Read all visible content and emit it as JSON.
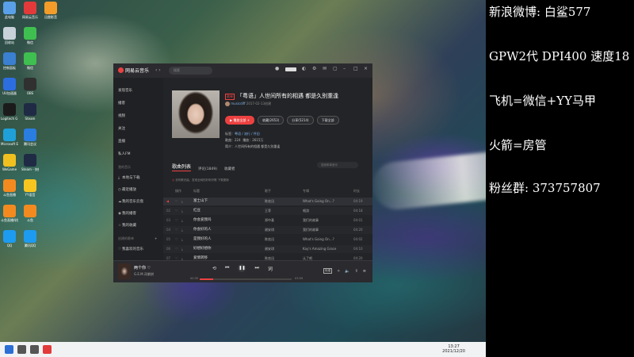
{
  "desktop": {
    "icons": [
      {
        "label": "此电脑",
        "color": "#5aa0e8",
        "col": 0,
        "row": 0
      },
      {
        "label": "网易云音乐",
        "color": "#e23a3a",
        "col": 1,
        "row": 0
      },
      {
        "label": "迅雷影音",
        "color": "#f39c2a",
        "col": 2,
        "row": 0
      },
      {
        "label": "回收站",
        "color": "#c8d0d8",
        "col": 0,
        "row": 1
      },
      {
        "label": "微信",
        "color": "#3fbf4f",
        "col": 1,
        "row": 1
      },
      {
        "label": "控制面板",
        "color": "#3a7fd0",
        "col": 0,
        "row": 2
      },
      {
        "label": "微信",
        "color": "#3fbf4f",
        "col": 1,
        "row": 2
      },
      {
        "label": "UU加速器",
        "color": "#2c6ee0",
        "col": 0,
        "row": 3
      },
      {
        "label": "OBS",
        "color": "#303030",
        "col": 1,
        "row": 3
      },
      {
        "label": "Logitech G HUB",
        "color": "#1b1b1b",
        "col": 0,
        "row": 4
      },
      {
        "label": "Steam",
        "color": "#1f2a44",
        "col": 1,
        "row": 4
      },
      {
        "label": "Microsoft Edge",
        "color": "#1fa0d8",
        "col": 0,
        "row": 5
      },
      {
        "label": "腾讯会议",
        "color": "#2a7de1",
        "col": 1,
        "row": 5
      },
      {
        "label": "WeGame",
        "color": "#f0c020",
        "col": 0,
        "row": 6
      },
      {
        "label": "Steam - 快捷方式",
        "color": "#1f2a44",
        "col": 1,
        "row": 6
      },
      {
        "label": "斗鱼直播",
        "color": "#f28a20",
        "col": 0,
        "row": 7
      },
      {
        "label": "YY语音",
        "color": "#f7c520",
        "col": 1,
        "row": 7
      },
      {
        "label": "斗鱼直播伴侣",
        "color": "#f28a20",
        "col": 0,
        "row": 8
      },
      {
        "label": "斗鱼",
        "color": "#f28a20",
        "col": 1,
        "row": 8
      },
      {
        "label": "QQ",
        "color": "#1d9bf0",
        "col": 0,
        "row": 9
      },
      {
        "label": "腾讯QQ",
        "color": "#1d9bf0",
        "col": 1,
        "row": 9
      }
    ]
  },
  "taskbar": {
    "time": "13:27",
    "date": "2021/12/20",
    "icons": [
      {
        "name": "start-icon",
        "color": "#2b6fd6"
      },
      {
        "name": "search-icon",
        "color": "#555"
      },
      {
        "name": "taskview-icon",
        "color": "#555"
      },
      {
        "name": "netease-taskbar-icon",
        "color": "#e23a3a"
      }
    ]
  },
  "app": {
    "logo_text": "网易云音乐",
    "search_placeholder": "搜索",
    "user_name": "",
    "sidebar": {
      "items": [
        "发现音乐",
        "播客",
        "视频",
        "关注",
        "直播",
        "私人FM"
      ],
      "section_mine": "我的音乐",
      "mine_items": [
        "本地与下载",
        "最近播放",
        "我的音乐云盘",
        "我的播客",
        "我的收藏"
      ],
      "section_created": "创建的歌单",
      "created_items": [
        "我喜欢的音乐"
      ]
    },
    "playlist": {
      "tag": "歌单",
      "title": "「粤语」人世间所有的相遇 都是久别重逢",
      "creator": "musicdiff",
      "created_date": "2017-02-13创建",
      "buttons": {
        "play_all": "播放全部",
        "favorite": "收藏(2653)",
        "share": "分享(5214)",
        "download": "下载全部"
      },
      "tags_label": "标签",
      "tags_value": "粤语 / 流行 / 怀旧",
      "songs_label": "歌曲",
      "songs_value": "224",
      "plays_label": "播放",
      "plays_value": "2615万",
      "intro_label": "简介",
      "intro_value": "人世间所有的相遇 都是久别重逢"
    },
    "tabs": [
      "歌曲列表",
      "评论(1849)",
      "收藏者"
    ],
    "list_search_placeholder": "搜索歌单音乐",
    "download_hint": "去听歌识曲，发现全网的好听好歌 下载更新",
    "columns": [
      "操作",
      "标题",
      "歌手",
      "专辑",
      "时长"
    ],
    "songs": [
      {
        "num": "",
        "title": "富士山下",
        "artist": "陈奕迅",
        "album": "What's Going On…?",
        "dur": "04:19",
        "state": "playing"
      },
      {
        "num": "02",
        "title": "红豆",
        "artist": "王菲",
        "album": "唱游",
        "dur": "04:18",
        "state": ""
      },
      {
        "num": "03",
        "title": "你会爱我吗",
        "artist": "郑中基",
        "album": "我们的故事",
        "dur": "04:01",
        "state": ""
      },
      {
        "num": "04",
        "title": "你会好的人",
        "artist": "谢安琪",
        "album": "我们的故事",
        "dur": "04:20",
        "state": ""
      },
      {
        "num": "05",
        "title": "是我好的人",
        "artist": "陈奕迅",
        "album": "What's Going On…?",
        "dur": "04:02",
        "state": ""
      },
      {
        "num": "06",
        "title": "好想好想你",
        "artist": "谢安琪",
        "album": "Kay's Amazing Grace",
        "dur": "04:10",
        "state": ""
      },
      {
        "num": "07",
        "title": "爱情转移",
        "artist": "陈奕迅",
        "album": "认了吧",
        "dur": "04:20",
        "state": ""
      },
      {
        "num": "08",
        "title": "好久不见",
        "artist": "陈奕迅",
        "album": "认了吧",
        "dur": "04:10",
        "state": ""
      }
    ],
    "player": {
      "title": "两个你",
      "artist": "G.E.M.邓紫棋",
      "time_current": "00:35",
      "time_total": "03:59",
      "progress": 0.15,
      "quality": "标准"
    }
  },
  "overlay": {
    "lines": [
      "新浪微博: 白鲨577",
      "GPW2代 DPI400 速度18",
      "飞机=微信+YY马甲",
      "火箭=房管",
      "粉丝群: 373757807"
    ]
  }
}
